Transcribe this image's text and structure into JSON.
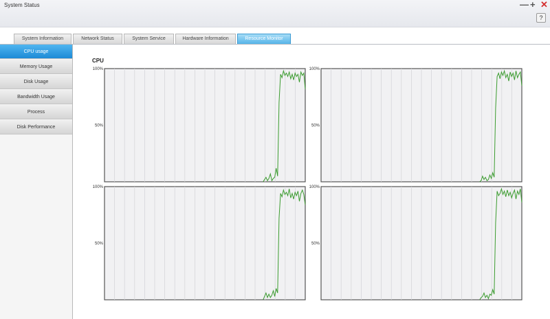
{
  "window": {
    "title": "System Status",
    "help": "?"
  },
  "tabs": [
    "System Information",
    "Network Status",
    "System Service",
    "Hardware Information",
    "Resource Monitor"
  ],
  "sidebar": [
    "CPU usage",
    "Memory Usage",
    "Disk Usage",
    "Bandwidth Usage",
    "Process",
    "Disk Performance"
  ],
  "main": {
    "section_label": "CPU"
  },
  "colors": {
    "line": "#3a9b2e",
    "accent": "#2c97e0"
  },
  "chart_data": [
    {
      "type": "line",
      "title": "",
      "ytick_labels": [
        "100%",
        "50%"
      ],
      "ylim": [
        0,
        100
      ],
      "series": [
        {
          "values": [
            0,
            2,
            4,
            1,
            3,
            7,
            1,
            3,
            4,
            12,
            5,
            70,
            95,
            92,
            98,
            94,
            96,
            93,
            97,
            91,
            95,
            90,
            96,
            93,
            95,
            88,
            97,
            94,
            96,
            82
          ]
        }
      ]
    },
    {
      "type": "line",
      "title": "",
      "ytick_labels": [
        "100%",
        "50%"
      ],
      "ylim": [
        0,
        100
      ],
      "series": [
        {
          "values": [
            0,
            1,
            5,
            2,
            4,
            1,
            2,
            6,
            3,
            8,
            4,
            65,
            93,
            96,
            91,
            97,
            94,
            98,
            92,
            95,
            89,
            97,
            93,
            96,
            90,
            98,
            92,
            95,
            97,
            85
          ]
        }
      ]
    },
    {
      "type": "line",
      "title": "",
      "ytick_labels": [
        "100%",
        "50%"
      ],
      "ylim": [
        0,
        100
      ],
      "series": [
        {
          "values": [
            0,
            3,
            6,
            2,
            5,
            2,
            4,
            8,
            3,
            10,
            6,
            72,
            94,
            91,
            97,
            93,
            95,
            92,
            98,
            90,
            94,
            89,
            95,
            92,
            96,
            87,
            94,
            97,
            93,
            84
          ]
        }
      ]
    },
    {
      "type": "line",
      "title": "",
      "ytick_labels": [
        "100%",
        "50%"
      ],
      "ylim": [
        0,
        100
      ],
      "series": [
        {
          "values": [
            0,
            2,
            3,
            6,
            2,
            4,
            1,
            5,
            4,
            9,
            5,
            68,
            96,
            92,
            94,
            98,
            93,
            96,
            91,
            97,
            92,
            95,
            90,
            94,
            97,
            89,
            96,
            93,
            98,
            86
          ]
        }
      ]
    }
  ]
}
